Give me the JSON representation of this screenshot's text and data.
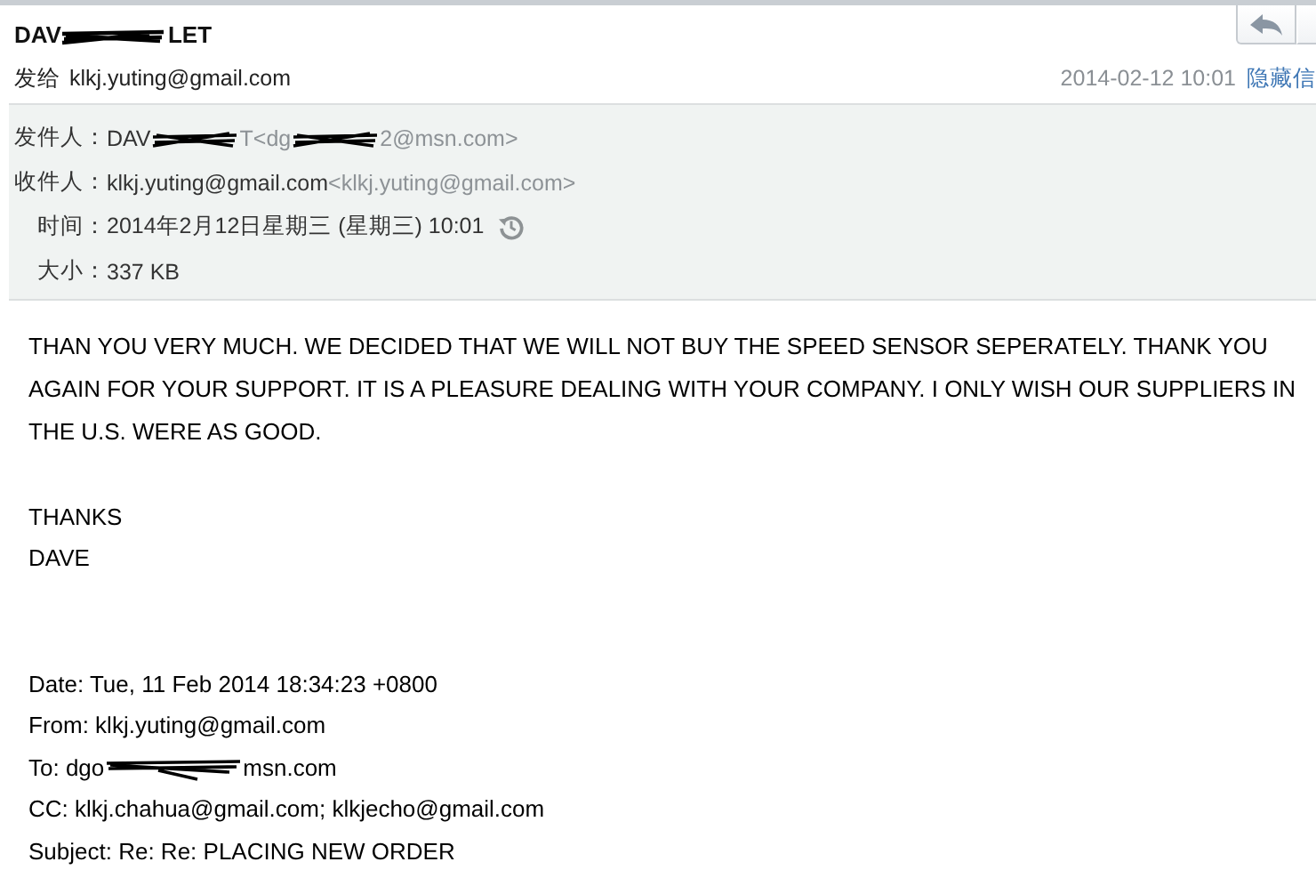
{
  "header": {
    "sender": [
      {
        "kind": "text",
        "text": "DAV"
      },
      {
        "kind": "redacted"
      },
      {
        "kind": "text",
        "text": "LET"
      }
    ],
    "to_label": "发给",
    "to_value": "klkj.yuting@gmail.com",
    "date": "2014-02-12 10:01",
    "hide_link": "隐藏信"
  },
  "details": [
    {
      "label": "发件人：",
      "parts": [
        {
          "kind": "text",
          "text": "DAV"
        },
        {
          "kind": "redacted"
        },
        {
          "kind": "muted",
          "text": "T<dg"
        },
        {
          "kind": "redacted"
        },
        {
          "kind": "muted",
          "text": "2@msn.com>"
        }
      ]
    },
    {
      "label": "收件人：",
      "parts": [
        {
          "kind": "text",
          "text": "klkj.yuting@gmail.com"
        },
        {
          "kind": "muted",
          "text": "<klkj.yuting@gmail.com>"
        }
      ]
    },
    {
      "label": "时间：",
      "parts": [
        {
          "kind": "text",
          "text": "2014年2月12日星期三 (星期三) 10:01"
        },
        {
          "kind": "history"
        }
      ]
    },
    {
      "label": "大小：",
      "parts": [
        {
          "kind": "text",
          "text": "337 KB"
        }
      ]
    }
  ],
  "body": [
    {
      "kind": "para",
      "text": "THAN YOU VERY MUCH.  WE DECIDED THAT WE WILL NOT BUY THE SPEED SENSOR SEPERATELY.  THANK YOU AGAIN FOR YOUR SUPPORT. IT IS A PLEASURE DEALING WITH YOUR COMPANY.  I ONLY WISH OUR SUPPLIERS IN THE U.S. WERE AS GOOD."
    },
    {
      "kind": "gap"
    },
    {
      "kind": "line",
      "parts": [
        {
          "kind": "text",
          "text": "THANKS"
        }
      ]
    },
    {
      "kind": "line",
      "parts": [
        {
          "kind": "text",
          "text": "DAVE"
        }
      ]
    },
    {
      "kind": "gap"
    },
    {
      "kind": "gap"
    },
    {
      "kind": "line",
      "parts": [
        {
          "kind": "text",
          "text": "Date: Tue, 11 Feb 2014 18:34:23 +0800"
        }
      ]
    },
    {
      "kind": "line",
      "parts": [
        {
          "kind": "text",
          "text": "From: klkj.yuting@gmail.com"
        }
      ]
    },
    {
      "kind": "line",
      "parts": [
        {
          "kind": "text",
          "text": "To: dgo"
        },
        {
          "kind": "redacted"
        },
        {
          "kind": "text",
          "text": "msn.com"
        }
      ]
    },
    {
      "kind": "line",
      "parts": [
        {
          "kind": "text",
          "text": "CC: klkj.chahua@gmail.com; klkjecho@gmail.com"
        }
      ]
    },
    {
      "kind": "line",
      "parts": [
        {
          "kind": "text",
          "text": "Subject: Re: Re: PLACING NEW ORDER"
        }
      ]
    }
  ]
}
